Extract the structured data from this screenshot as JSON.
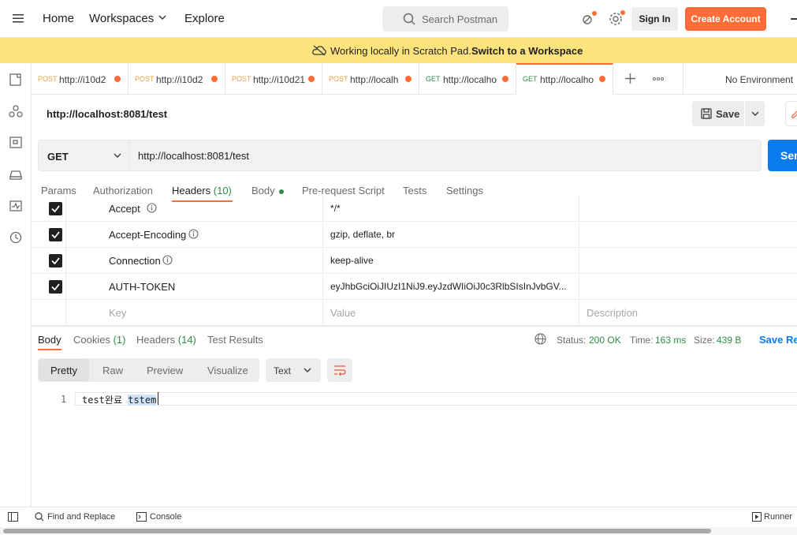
{
  "topbar": {
    "nav": [
      "Home",
      "Workspaces",
      "Explore"
    ],
    "search_placeholder": "Search Postman",
    "signin_label": "Sign In",
    "create_label": "Create Account"
  },
  "banner": {
    "text": "Working locally in Scratch Pad.",
    "link": "Switch to a Workspace"
  },
  "tabs": [
    {
      "method": "POST",
      "url": "http://i10d2"
    },
    {
      "method": "POST",
      "url": "http://i10d2"
    },
    {
      "method": "POST",
      "url": "http://i10d21"
    },
    {
      "method": "POST",
      "url": "http://localh"
    },
    {
      "method": "GET",
      "url": "http://localho"
    },
    {
      "method": "GET",
      "url": "http://localho"
    }
  ],
  "environment": "No Environment",
  "request": {
    "title": "http://localhost:8081/test",
    "save_label": "Save",
    "method": "GET",
    "url": "http://localhost:8081/test",
    "send_label": "Send"
  },
  "request_tabs": {
    "params": "Params",
    "authorization": "Authorization",
    "headers": "Headers",
    "headers_count": "(10)",
    "body": "Body",
    "prerequest": "Pre-request Script",
    "tests": "Tests",
    "settings": "Settings"
  },
  "headers": [
    {
      "key": "Accept",
      "value": "*/*"
    },
    {
      "key": "Accept-Encoding",
      "value": "gzip, deflate, br"
    },
    {
      "key": "Connection",
      "value": "keep-alive"
    },
    {
      "key": "AUTH-TOKEN",
      "value": "eyJhbGciOiJIUzI1NiJ9.eyJzdWIiOiJ0c3RlbSIsInJvbGV..."
    }
  ],
  "headers_placeholder": {
    "key": "Key",
    "value": "Value",
    "description": "Description"
  },
  "response": {
    "tabs": {
      "body": "Body",
      "cookies": "Cookies",
      "cookies_count": "(1)",
      "headers": "Headers",
      "headers_count": "(14)",
      "test_results": "Test Results"
    },
    "status_label": "Status:",
    "status_value": "200 OK",
    "time_label": "Time:",
    "time_value": "163 ms",
    "size_label": "Size:",
    "size_value": "439 B",
    "save_response": "Save Response",
    "formats": [
      "Pretty",
      "Raw",
      "Preview",
      "Visualize"
    ],
    "text_type": "Text",
    "line_number": "1",
    "code_plain": "test완료 ",
    "code_highlight": "tstem"
  },
  "footer": {
    "find_replace": "Find and Replace",
    "console": "Console",
    "runner": "Runner"
  },
  "colors": {
    "accent": "#ff6c37",
    "banner": "#ffe47e",
    "send": "#097bed",
    "status_ok": "#2e8c47"
  }
}
